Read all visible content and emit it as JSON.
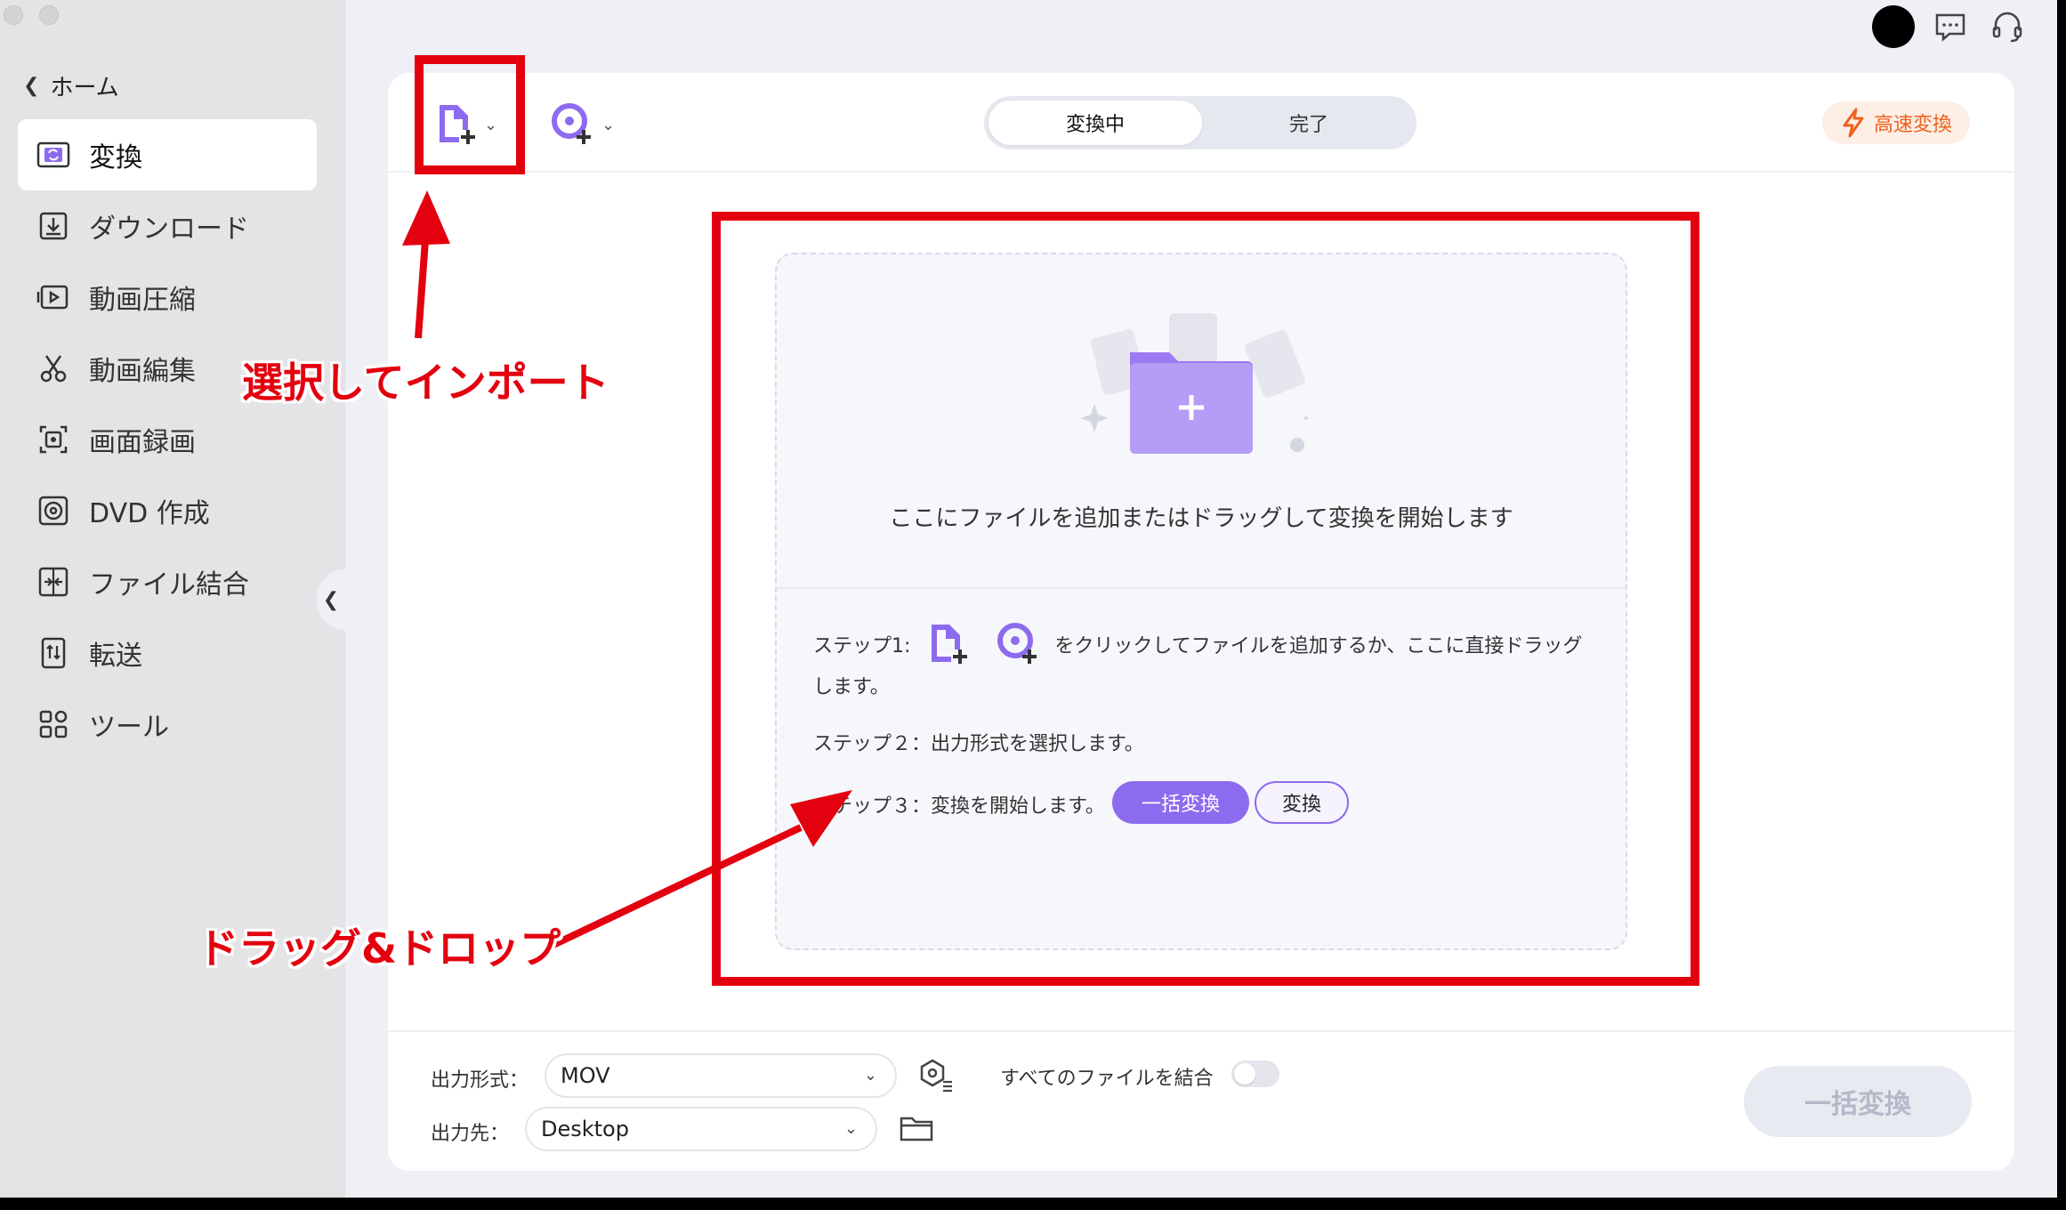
{
  "sidebar": {
    "home_label": "ホーム",
    "items": [
      {
        "label": "変換",
        "icon": "convert-icon"
      },
      {
        "label": "ダウンロード",
        "icon": "download-icon"
      },
      {
        "label": "動画圧縮",
        "icon": "compress-icon"
      },
      {
        "label": "動画編集",
        "icon": "scissors-icon"
      },
      {
        "label": "画面録画",
        "icon": "screen-record-icon"
      },
      {
        "label": "DVD 作成",
        "icon": "dvd-icon"
      },
      {
        "label": "ファイル結合",
        "icon": "merge-icon"
      },
      {
        "label": "転送",
        "icon": "transfer-icon"
      },
      {
        "label": "ツール",
        "icon": "tools-icon"
      }
    ],
    "active_index": 0
  },
  "toolbar": {
    "tabs": [
      "変換中",
      "完了"
    ],
    "fast_convert_label": "高速変換"
  },
  "dropzone": {
    "main_text": "ここにファイルを追加またはドラッグして変換を開始します",
    "step1_prefix": "ステップ1:",
    "step1_text": "をクリックしてファイルを追加するか、ここに直接ドラッグ",
    "step1_cont": "します。",
    "step2_text": "ステップ２：出力形式を選択します。",
    "step3_text": "ステップ３：変換を開始します。",
    "batch_pill": "一括変換",
    "convert_pill": "変換"
  },
  "bottom": {
    "format_label": "出力形式：",
    "format_value": "MOV",
    "dest_label": "出力先：",
    "dest_value": "Desktop",
    "merge_label": "すべてのファイルを結合",
    "merge_on": false,
    "batch_button": "一括変換"
  },
  "annotations": {
    "import_label": "選択してインポート",
    "dragdrop_label": "ドラッグ&ドロップ",
    "color": "#e3000f"
  },
  "colors": {
    "accent": "#8d6bef",
    "fast": "#f0611d"
  }
}
